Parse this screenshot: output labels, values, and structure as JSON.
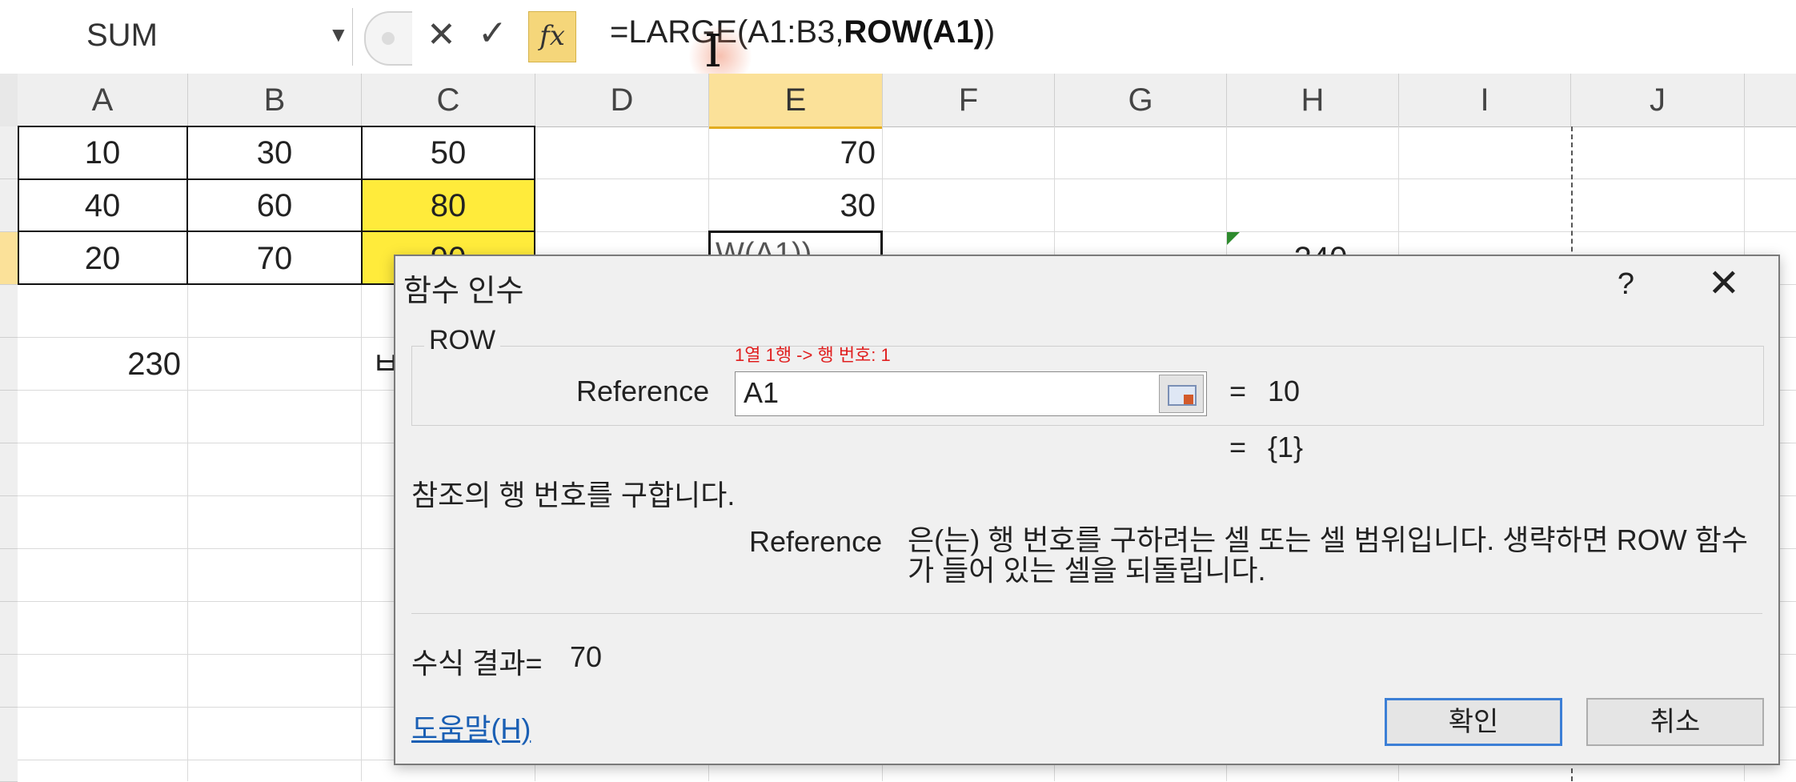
{
  "formula_bar": {
    "name_box": "SUM",
    "formula_prefix": "=LARGE(A1:B3,",
    "formula_bold": "ROW(A1)",
    "formula_suffix": ")"
  },
  "columns": [
    "A",
    "B",
    "C",
    "D",
    "E",
    "F",
    "G",
    "H",
    "I",
    "J"
  ],
  "selected_column": "E",
  "cells": {
    "a1": "10",
    "b1": "30",
    "c1": "50",
    "e1": "70",
    "a2": "40",
    "b2": "60",
    "c2": "80",
    "e2": "30",
    "a3": "20",
    "b3": "70",
    "c3": "90",
    "e3": "W(A1))",
    "h3": "240",
    "a5": "230",
    "c5": "ㅂ"
  },
  "highlight_color": "#ffeb3b",
  "dialog": {
    "title": "함수 인수",
    "help_glyph": "?",
    "close_glyph": "✕",
    "function_name": "ROW",
    "annotation": "1열 1행 -> 행 번호: 1",
    "arg_label": "Reference",
    "arg_value": "A1",
    "eq": "=",
    "arg_result": "10",
    "func_result": "{1}",
    "description": "참조의 행 번호를 구합니다.",
    "arg_help_name": "Reference",
    "arg_help_text": "은(는) 행 번호를 구하려는 셀 또는 셀 범위입니다. 생략하면 ROW 함수가 들어 있는 셀을 되돌립니다.",
    "result_label": "수식 결과=",
    "result_value": "70",
    "help_link": "도움말(H)",
    "ok": "확인",
    "cancel": "취소"
  }
}
